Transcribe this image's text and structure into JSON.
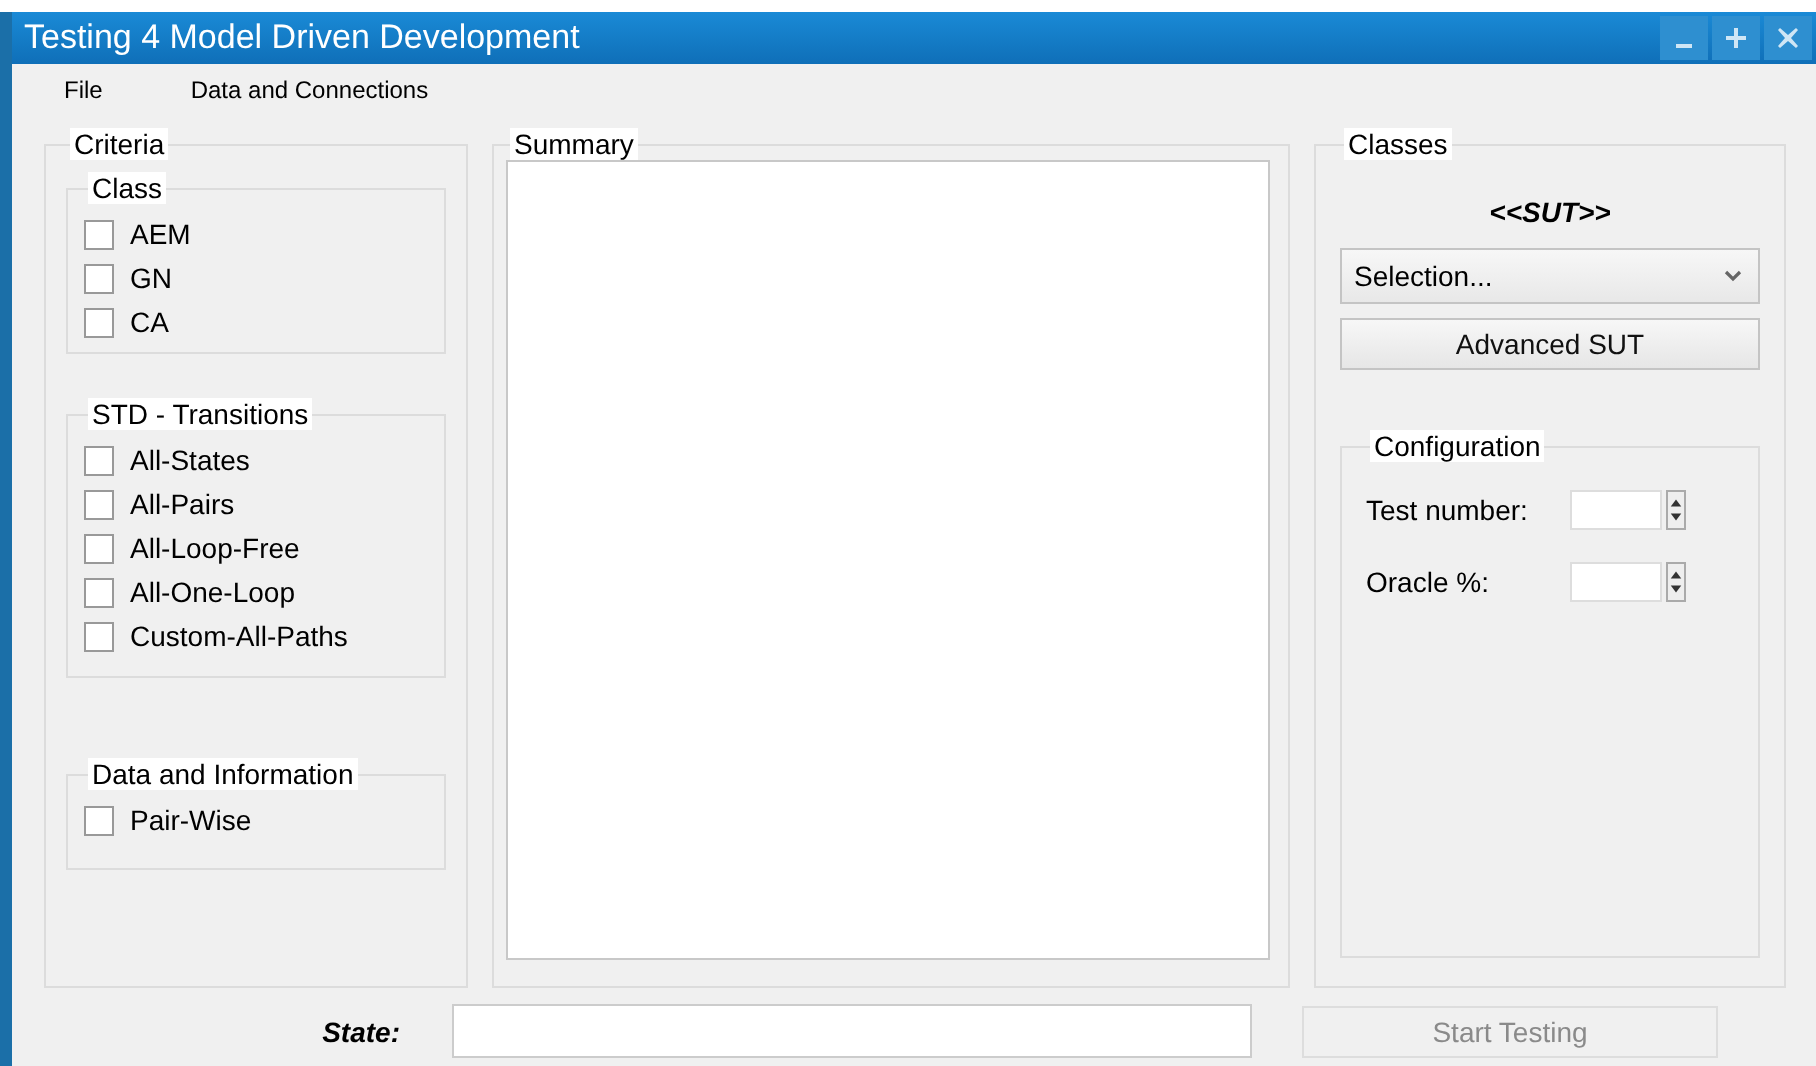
{
  "window": {
    "title": "Testing 4 Model Driven Development"
  },
  "menu": [
    "File",
    "Data and Connections"
  ],
  "criteria": {
    "title": "Criteria",
    "groups": [
      {
        "title": "Class",
        "options": [
          {
            "label": "AEM",
            "checked": false
          },
          {
            "label": "GN",
            "checked": false
          },
          {
            "label": "CA",
            "checked": false
          }
        ]
      },
      {
        "title": "STD - Transitions",
        "options": [
          {
            "label": "All-States",
            "checked": false
          },
          {
            "label": "All-Pairs",
            "checked": false
          },
          {
            "label": "All-Loop-Free",
            "checked": false
          },
          {
            "label": "All-One-Loop",
            "checked": false
          },
          {
            "label": "Custom-All-Paths",
            "checked": false
          }
        ]
      },
      {
        "title": "Data and Information",
        "options": [
          {
            "label": "Pair-Wise",
            "checked": false
          }
        ]
      }
    ]
  },
  "summary": {
    "title": "Summary"
  },
  "classes": {
    "title": "Classes",
    "sut_label": "<<SUT>>",
    "dropdown": "Selection...",
    "advanced_button": "Advanced SUT",
    "configuration": {
      "title": "Configuration",
      "fields": [
        {
          "label": "Test number:"
        },
        {
          "label": "Oracle %:"
        }
      ]
    }
  },
  "state": {
    "label": "State:"
  },
  "start_button": {
    "label": "Start Testing",
    "disabled": true
  }
}
